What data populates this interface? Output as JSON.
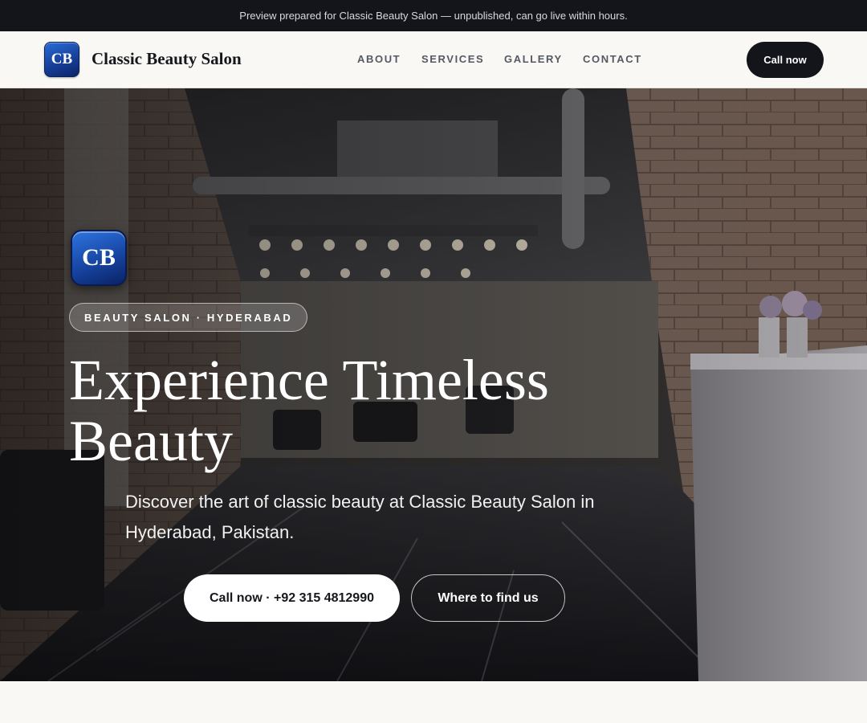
{
  "banner": {
    "text": "Preview prepared for Classic Beauty Salon — unpublished, can go live within hours."
  },
  "header": {
    "logo_text": "CB",
    "brand": "Classic Beauty Salon",
    "nav": [
      "ABOUT",
      "SERVICES",
      "GALLERY",
      "CONTACT"
    ],
    "cta_label": "Call now"
  },
  "hero": {
    "logo_text": "CB",
    "badge": "BEAUTY SALON · HYDERABAD",
    "headline": "Experience Timeless Beauty",
    "subtext": "Discover the art of classic beauty at Classic Beauty Salon in Hyderabad, Pakistan.",
    "primary_button": "Call now · +92 315 4812990",
    "secondary_button": "Where to find us"
  },
  "colors": {
    "dark": "#13151a",
    "page_bg": "#f9f8f5",
    "logo_blue": "#1745a3"
  }
}
